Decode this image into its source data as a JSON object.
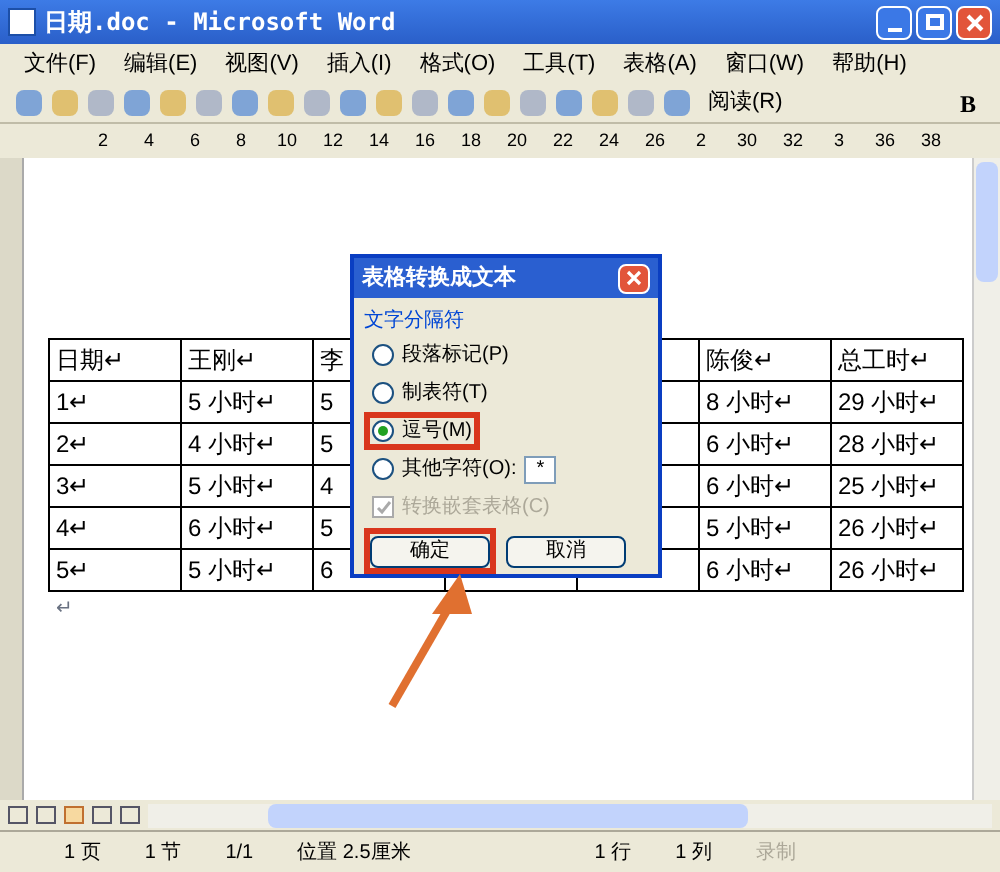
{
  "window": {
    "title": "日期.doc - Microsoft Word"
  },
  "menu": [
    "文件(F)",
    "编辑(E)",
    "视图(V)",
    "插入(I)",
    "格式(O)",
    "工具(T)",
    "表格(A)",
    "窗口(W)",
    "帮助(H)"
  ],
  "toolbar": {
    "read_button": "阅读(R)",
    "bold_button": "B"
  },
  "ruler": [
    "2",
    "4",
    "6",
    "8",
    "10",
    "12",
    "14",
    "16",
    "18",
    "20",
    "22",
    "24",
    "26",
    "2",
    "30",
    "32",
    "3",
    "36",
    "38"
  ],
  "table": {
    "rows": [
      [
        "日期↵",
        "王刚↵",
        "李",
        "",
        "",
        "陈俊↵",
        "总工时↵"
      ],
      [
        "1↵",
        "5 小时↵",
        "5",
        "",
        "",
        "8 小时↵",
        "29 小时↵"
      ],
      [
        "2↵",
        "4 小时↵",
        "5",
        "",
        "",
        "6 小时↵",
        "28 小时↵"
      ],
      [
        "3↵",
        "5 小时↵",
        "4",
        "",
        "",
        "6 小时↵",
        "25 小时↵"
      ],
      [
        "4↵",
        "6 小时↵",
        "5",
        "",
        "",
        "5 小时↵",
        "26 小时↵"
      ],
      [
        "5↵",
        "5 小时↵",
        "6",
        "",
        "",
        "6 小时↵",
        "26 小时↵"
      ]
    ]
  },
  "paragraph_mark": "↵",
  "dialog": {
    "title": "表格转换成文本",
    "group": "文字分隔符",
    "options": [
      {
        "label": "段落标记(P)",
        "selected": false,
        "highlighted": false
      },
      {
        "label": "制表符(T)",
        "selected": false,
        "highlighted": false
      },
      {
        "label": "逗号(M)",
        "selected": true,
        "highlighted": true
      },
      {
        "label": "其他字符(O):",
        "selected": false,
        "highlighted": false
      }
    ],
    "other_value": "*",
    "nested": {
      "label": "转换嵌套表格(C)",
      "checked": true,
      "disabled": true
    },
    "buttons": [
      {
        "label": "确定",
        "highlighted": true
      },
      {
        "label": "取消",
        "highlighted": false
      }
    ]
  },
  "status_bar": [
    "1 页",
    "1 节",
    "1/1",
    "位置 2.5厘米",
    "1 行",
    "1 列",
    "录制"
  ]
}
